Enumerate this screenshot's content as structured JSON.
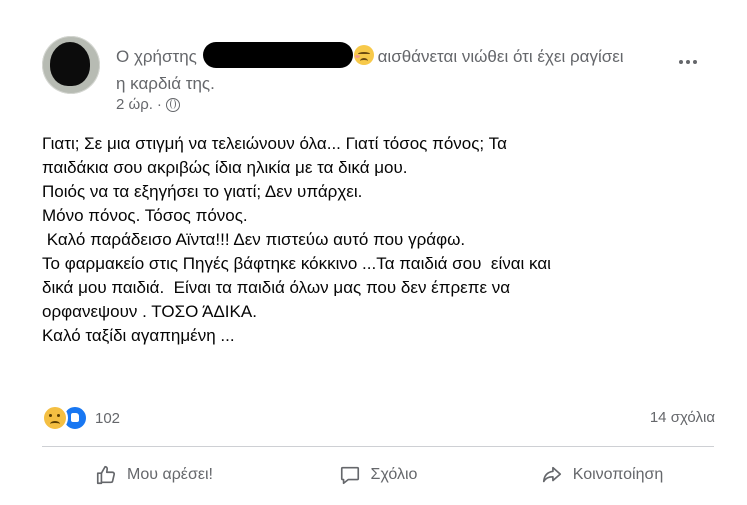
{
  "post": {
    "author_prefix": "Ο χρήστης",
    "feeling_text": "αισθάνεται νιώθει ότι έχει ραγίσει η καρδιά της.",
    "timestamp": "2 ώρ.",
    "separator": "·",
    "privacy_icon": "globe-icon",
    "more_icon": "more-options-icon",
    "body_lines": [
      "Γιατι; Σε μια στιγμή να τελειώνουν όλα... Γιατί τόσος πόνος; Τα",
      "παιδάκια σου ακριβώς ίδια ηλικία με τα δικά μου.",
      "Ποιός να τα εξηγήσει το γιατί; Δεν υπάρχει.",
      "Μόνο πόνος. Τόσος πόνος.",
      " Καλό παράδεισο Αϊντα!!! Δεν πιστεύω αυτό που γράφω.",
      "Το φαρμακείο στις Πηγές βάφτηκε κόκκινο ...Τα παιδιά σου  είναι και",
      "δικά μου παιδιά.  Είναι τα παιδιά όλων μας που δεν έπρεπε να",
      "ορφανεψουν . ΤΟΣΟ ΆΔΙΚΑ.",
      "Καλό ταξίδι αγαπημένη ..."
    ]
  },
  "stats": {
    "reaction_icons": [
      "sad-reaction-icon",
      "like-reaction-icon"
    ],
    "reaction_count": "102",
    "comments": "14 σχόλια"
  },
  "actions": {
    "like": "Μου αρέσει!",
    "comment": "Σχόλιο",
    "share": "Κοινοποίηση"
  },
  "colors": {
    "secondary_text": "#65676b",
    "like_blue": "#1877f2",
    "divider": "#ced0d4"
  }
}
